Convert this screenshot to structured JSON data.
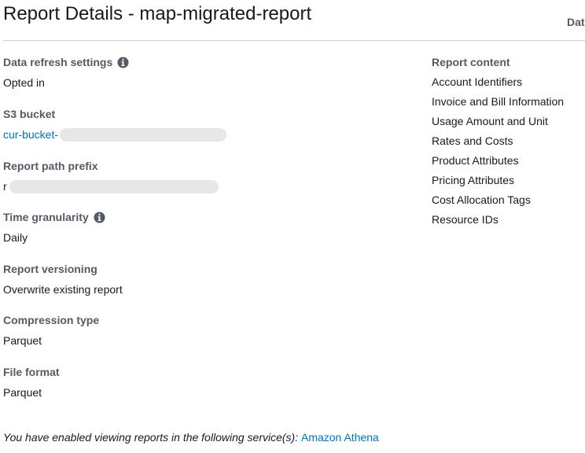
{
  "header": {
    "title": "Report Details - map-migrated-report",
    "top_right_fragment": "Dat"
  },
  "fields": {
    "refresh": {
      "label": "Data refresh settings",
      "value": "Opted in"
    },
    "s3": {
      "label": "S3 bucket",
      "value": "cur-bucket-"
    },
    "prefix": {
      "label": "Report path prefix",
      "value": "r"
    },
    "granularity": {
      "label": "Time granularity",
      "value": "Daily"
    },
    "versioning": {
      "label": "Report versioning",
      "value": "Overwrite existing report"
    },
    "compression": {
      "label": "Compression type",
      "value": "Parquet"
    },
    "format": {
      "label": "File format",
      "value": "Parquet"
    }
  },
  "report_content": {
    "label": "Report content",
    "items": [
      "Account Identifiers",
      "Invoice and Bill Information",
      "Usage Amount and Unit",
      "Rates and Costs",
      "Product Attributes",
      "Pricing Attributes",
      "Cost Allocation Tags",
      "Resource IDs"
    ]
  },
  "footer": {
    "text": "You have enabled viewing reports in the following service(s): ",
    "link": "Amazon Athena"
  },
  "colors": {
    "link": "#0073bb",
    "label": "#545b64",
    "redaction": "#e7e7e7"
  },
  "icons": {
    "info": "info-icon"
  }
}
